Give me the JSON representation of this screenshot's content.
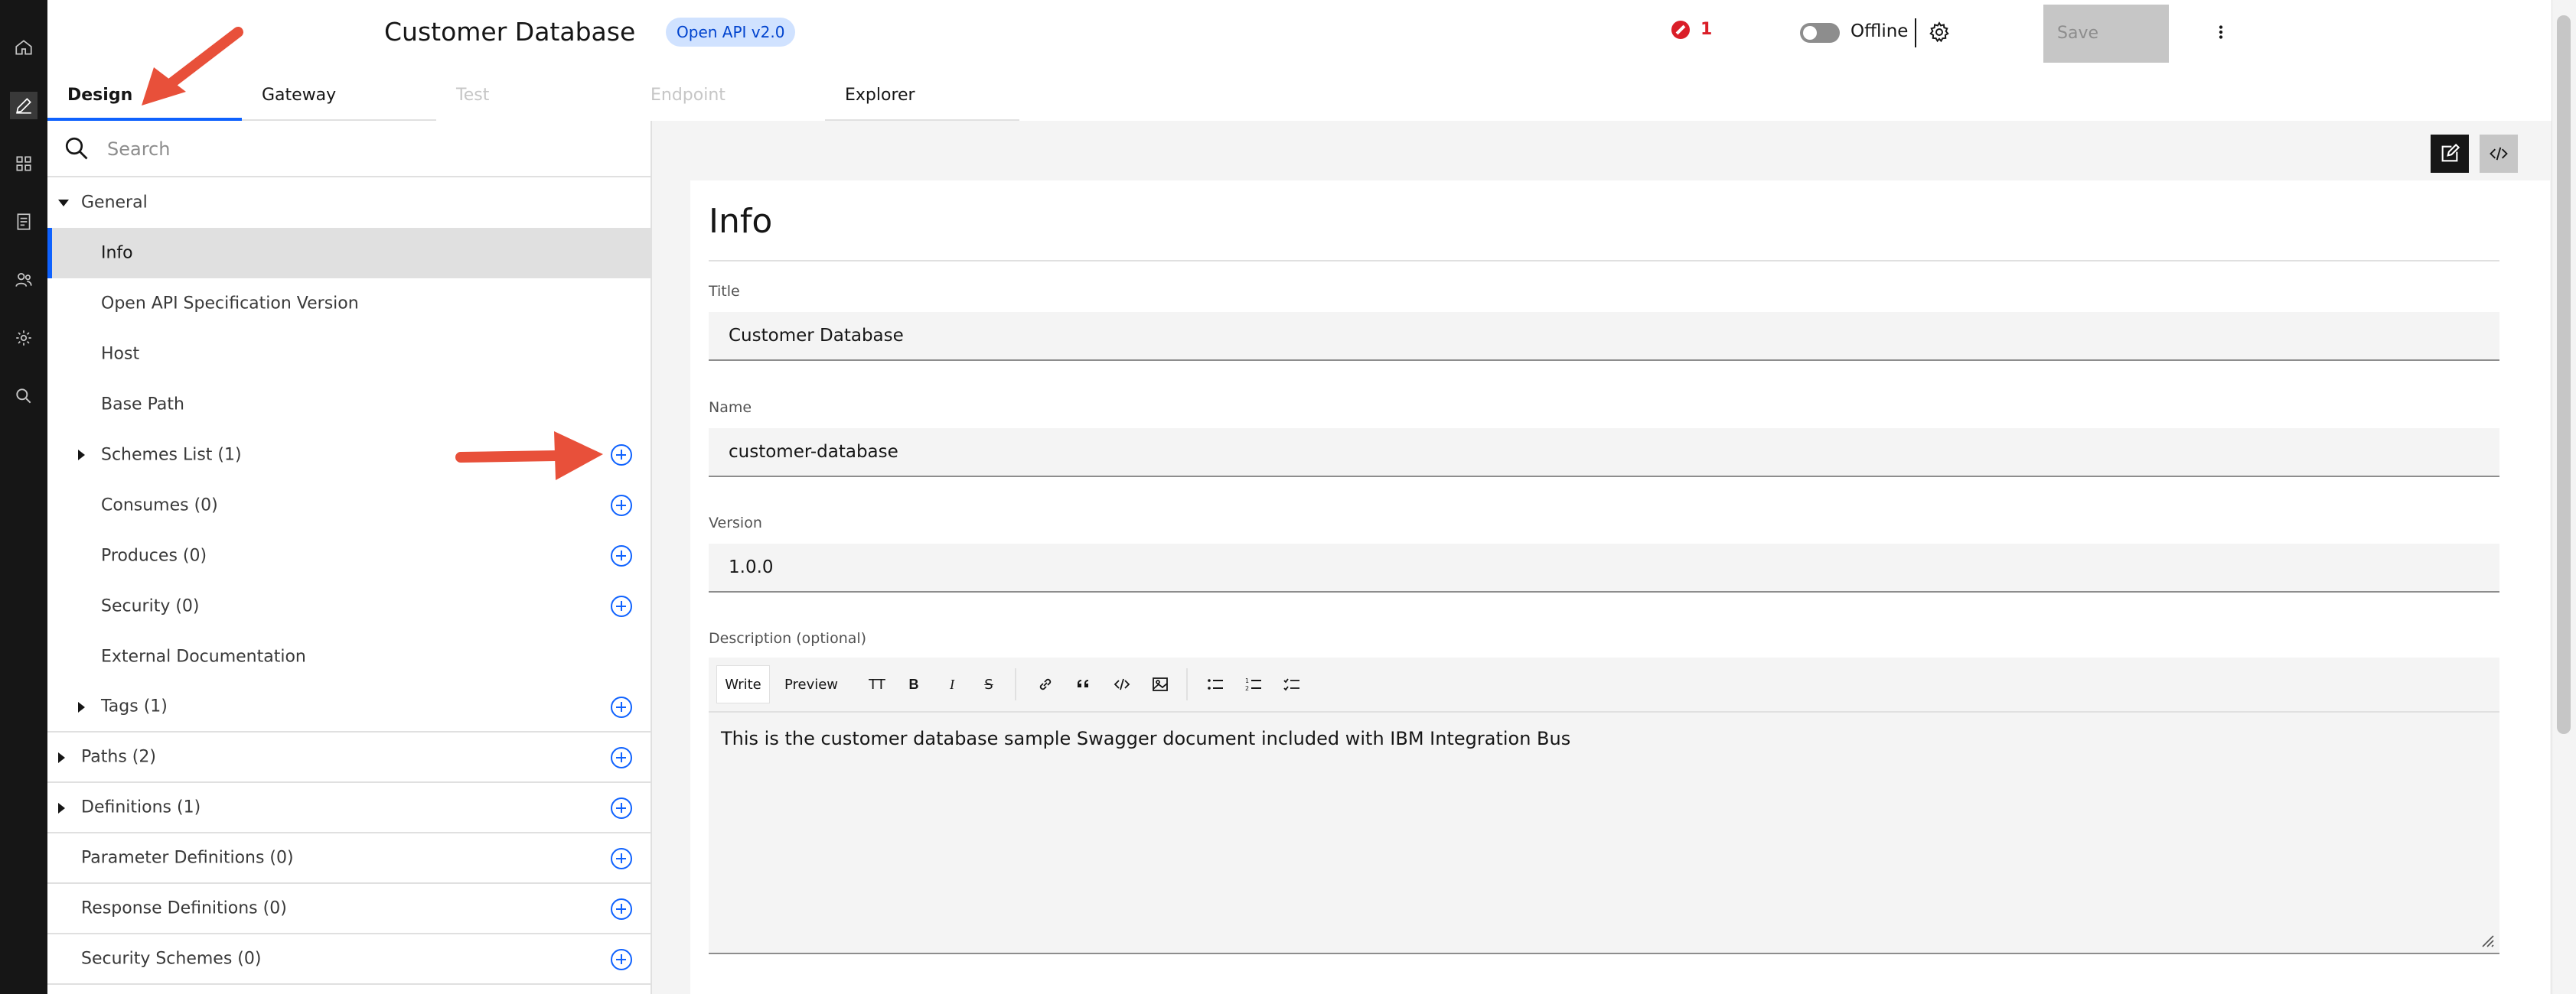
{
  "header": {
    "title": "Customer Database",
    "spec_tag": "Open API v2.0",
    "error_count": "1",
    "offline_label": "Offline",
    "save_label": "Save"
  },
  "rail": {
    "icons": [
      "home-icon",
      "edit-icon",
      "apps-icon",
      "document-icon",
      "users-icon",
      "settings-icon",
      "search-icon"
    ]
  },
  "tabs": [
    {
      "label": "Design",
      "state": "selected"
    },
    {
      "label": "Gateway",
      "state": "normal"
    },
    {
      "label": "Test",
      "state": "disabled"
    },
    {
      "label": "Endpoint",
      "state": "disabled"
    },
    {
      "label": "Explorer",
      "state": "normal"
    }
  ],
  "sidebar": {
    "search_placeholder": "Search",
    "items": [
      {
        "label": "General",
        "level": 0,
        "caret": "down",
        "add": false
      },
      {
        "label": "Info",
        "level": 1,
        "caret": "",
        "add": false,
        "selected": true
      },
      {
        "label": "Open API Specification Version",
        "level": 1,
        "caret": "",
        "add": false
      },
      {
        "label": "Host",
        "level": 1,
        "caret": "",
        "add": false
      },
      {
        "label": "Base Path",
        "level": 1,
        "caret": "",
        "add": false
      },
      {
        "label": "Schemes List (1)",
        "level": 1,
        "caret": "right",
        "add": true
      },
      {
        "label": "Consumes (0)",
        "level": 1,
        "caret": "",
        "add": true
      },
      {
        "label": "Produces (0)",
        "level": 1,
        "caret": "",
        "add": true
      },
      {
        "label": "Security (0)",
        "level": 1,
        "caret": "",
        "add": true
      },
      {
        "label": "External Documentation",
        "level": 1,
        "caret": "",
        "add": false
      },
      {
        "label": "Tags (1)",
        "level": 1,
        "caret": "right",
        "add": true
      },
      {
        "label": "Paths (2)",
        "level": 0,
        "caret": "right",
        "add": true
      },
      {
        "label": "Definitions (1)",
        "level": 0,
        "caret": "right",
        "add": true
      },
      {
        "label": "Parameter Definitions (0)",
        "level": 0,
        "caret": "",
        "add": true
      },
      {
        "label": "Response Definitions (0)",
        "level": 0,
        "caret": "",
        "add": true
      },
      {
        "label": "Security Schemes (0)",
        "level": 0,
        "caret": "",
        "add": true
      }
    ]
  },
  "info": {
    "heading": "Info",
    "title_label": "Title",
    "title_value": "Customer Database",
    "name_label": "Name",
    "name_value": "customer-database",
    "version_label": "Version",
    "version_value": "1.0.0",
    "description_label": "Description (optional)",
    "description_value": "This is the customer database sample Swagger document included with IBM Integration Bus"
  },
  "editor_toolbar": {
    "write_label": "Write",
    "preview_label": "Preview",
    "heading_label": "TT",
    "bold_label": "B",
    "italic_label": "I",
    "strike_label": "S"
  },
  "colors": {
    "accent": "#0f62fe",
    "error": "#da1e28",
    "annotation": "#e8503a",
    "rail": "#161616"
  }
}
